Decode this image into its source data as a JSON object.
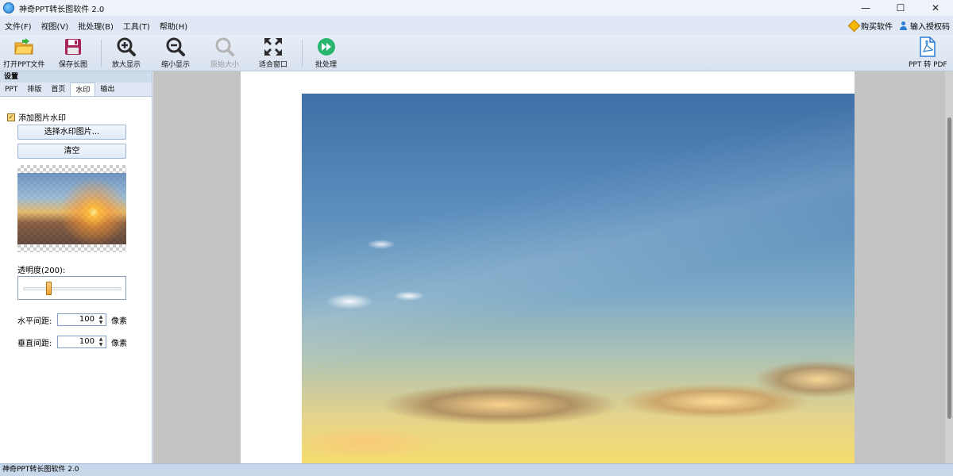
{
  "window": {
    "title": "神奇PPT转长图软件 2.0"
  },
  "menu": {
    "items": [
      "文件(F)",
      "视图(V)",
      "批处理(B)",
      "工具(T)",
      "帮助(H)"
    ],
    "buy_label": "购买软件",
    "license_label": "输入授权码"
  },
  "toolbar": {
    "open_ppt": "打开PPT文件",
    "save_long_image": "保存长图",
    "zoom_in": "放大显示",
    "zoom_out": "缩小显示",
    "original_size": "原始大小",
    "fit_window": "适合窗口",
    "batch": "批处理",
    "ppt_to_pdf": "PPT 转 PDF"
  },
  "panel": {
    "header": "设置",
    "tabs": [
      "PPT",
      "排版",
      "首页",
      "水印",
      "输出"
    ],
    "active_tab": "水印",
    "watermark": {
      "add_image_label": "添加图片水印",
      "select_image_button": "选择水印图片...",
      "clear_button": "清空",
      "opacity_label": "透明度(200):",
      "opacity_value": 200,
      "opacity_max": 255,
      "h_spacing_label": "水平间距:",
      "h_spacing_value": "100",
      "v_spacing_label": "垂直间距:",
      "v_spacing_value": "100",
      "unit": "像素"
    }
  },
  "status": {
    "text": "神奇PPT转长图软件 2.0"
  },
  "colors": {
    "accent": "#2a7fd4",
    "panel_bg": "#dfe8f4"
  }
}
